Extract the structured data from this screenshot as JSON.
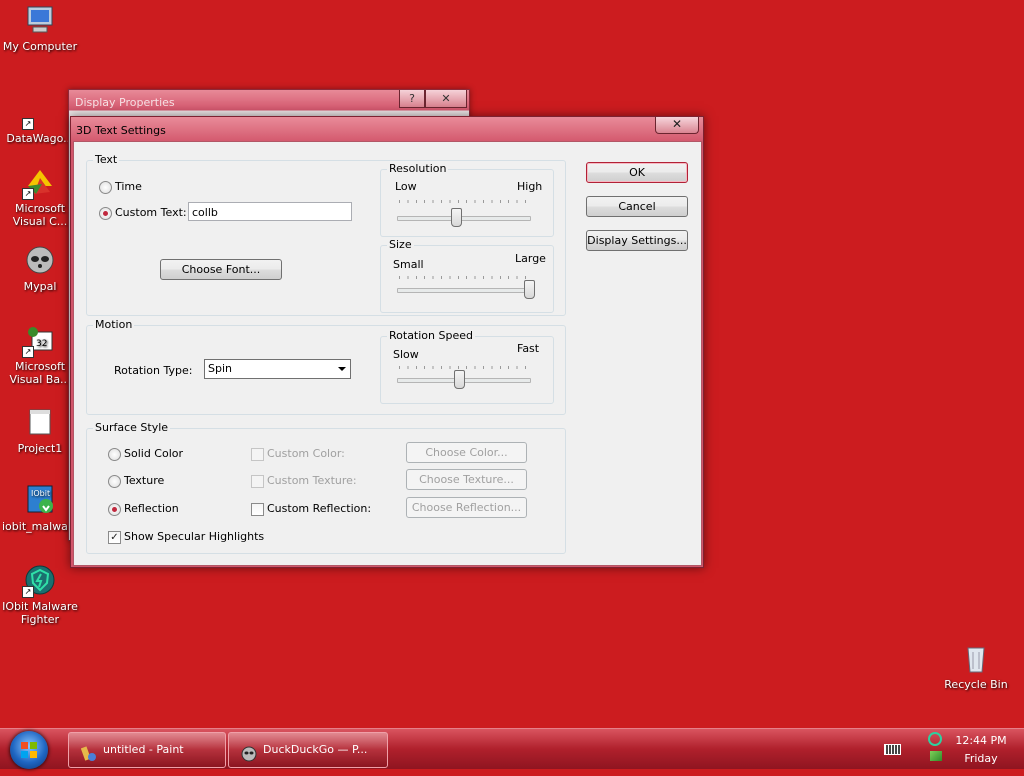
{
  "desktop": {
    "icons": [
      {
        "label": "My Computer"
      },
      {
        "label": "DataWago..."
      },
      {
        "label": "Microsoft Visual C..."
      },
      {
        "label": "Mypal"
      },
      {
        "label": "Microsoft Visual Ba..."
      },
      {
        "label": "Project1"
      },
      {
        "label": "iobit_malwa..."
      },
      {
        "label": "IObit Malware Fighter"
      },
      {
        "label": "Recycle Bin"
      }
    ]
  },
  "background_window": {
    "title": "Display Properties",
    "help_label": "?",
    "close_label": "✕"
  },
  "dialog": {
    "title": "3D Text Settings",
    "close_label": "✕",
    "text_group": {
      "label": "Text",
      "time_label": "Time",
      "custom_text_label": "Custom Text:",
      "custom_text_value": "collb",
      "choose_font_label": "Choose Font..."
    },
    "resolution": {
      "label": "Resolution",
      "min_label": "Low",
      "max_label": "High",
      "level": 0.45
    },
    "size": {
      "label": "Size",
      "min_label": "Small",
      "max_label": "Large",
      "level": 1.0
    },
    "motion": {
      "label": "Motion",
      "rotation_type_label": "Rotation Type:",
      "rotation_type_value": "Spin"
    },
    "rotation_speed": {
      "label": "Rotation Speed",
      "min_label": "Slow",
      "max_label": "Fast",
      "level": 0.47
    },
    "surface": {
      "label": "Surface Style",
      "solid_color_label": "Solid Color",
      "texture_label": "Texture",
      "reflection_label": "Reflection",
      "custom_color_label": "Custom Color:",
      "custom_texture_label": "Custom Texture:",
      "custom_reflection_label": "Custom Reflection:",
      "choose_color_label": "Choose Color...",
      "choose_texture_label": "Choose Texture...",
      "choose_reflection_label": "Choose Reflection...",
      "specular_label": "Show Specular Highlights"
    },
    "buttons": {
      "ok_label": "OK",
      "cancel_label": "Cancel",
      "display_settings_label": "Display Settings..."
    }
  },
  "taskbar": {
    "tasks": [
      {
        "label": "untitled - Paint"
      },
      {
        "label": "DuckDuckGo — P..."
      }
    ],
    "clock_time": "12:44 PM",
    "clock_day": "Friday"
  },
  "colors": {
    "desktop_bg": "#cc1c1f",
    "selection_accent": "#c0283d"
  }
}
